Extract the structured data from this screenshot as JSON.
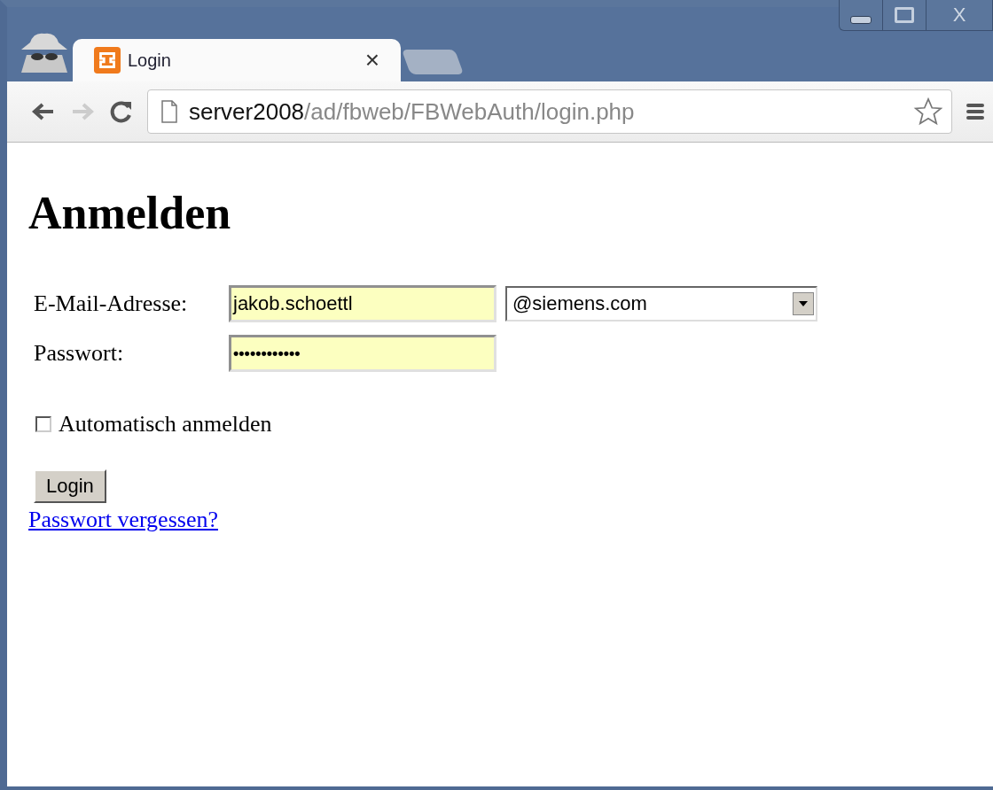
{
  "window": {
    "controls": {
      "close": "X"
    }
  },
  "tabs": [
    {
      "title": "Login",
      "close": "×",
      "selected": true
    }
  ],
  "address_bar": {
    "host": "server2008",
    "path": "/ad/fbweb/FBWebAuth/login.php"
  },
  "page": {
    "heading": "Anmelden",
    "email": {
      "label": "E-Mail-Adresse:",
      "value": "jakob.schoettl",
      "domain": "@siemens.com"
    },
    "password": {
      "label": "Passwort:",
      "value": "••••••••••••"
    },
    "auto_login": {
      "label": "Automatisch anmelden",
      "checked": false
    },
    "login_button": "Login",
    "forgot_link": "Passwort vergessen?"
  }
}
